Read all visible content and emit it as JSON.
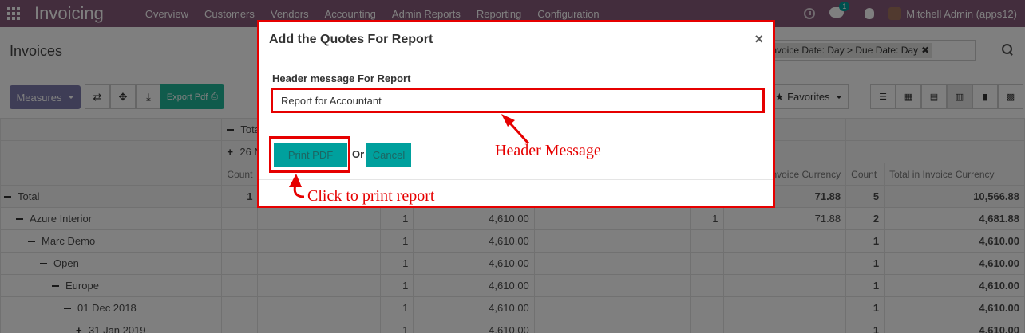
{
  "navbar": {
    "brand": "Invoicing",
    "menu": [
      "Overview",
      "Customers",
      "Vendors",
      "Accounting",
      "Admin Reports",
      "Reporting",
      "Configuration"
    ],
    "chat_badge": "1",
    "user": "Mitchell Admin (apps12)"
  },
  "control_panel": {
    "title": "Invoices",
    "facet": "Invoice Date: Day > Due Date: Day",
    "measures_label": "Measures",
    "export_label": "Export Pdf",
    "favorites_label": "Favorites"
  },
  "pivot": {
    "header_total": "Total",
    "header_col": "26 N",
    "subheaders": [
      "Count",
      "Invoice Currency",
      "Count",
      "Total in Invoice Currency"
    ],
    "rows": [
      {
        "label": "Total",
        "level": 0,
        "icon": "minus",
        "bold": true,
        "c1": "1",
        "c2": "",
        "c3": "",
        "c4": "",
        "c5": "",
        "c6": "71.88",
        "c7": "5",
        "c8": "10,566.88"
      },
      {
        "label": "Azure Interior",
        "level": 1,
        "icon": "minus",
        "bold": false,
        "c1": "",
        "c2": "",
        "c3": "1",
        "c4": "4,610.00",
        "c5": "1",
        "c6": "71.88",
        "c7": "2",
        "c8": "4,681.88"
      },
      {
        "label": "Marc Demo",
        "level": 2,
        "icon": "minus",
        "bold": false,
        "c1": "",
        "c2": "",
        "c3": "1",
        "c4": "4,610.00",
        "c5": "",
        "c6": "",
        "c7": "1",
        "c8": "4,610.00"
      },
      {
        "label": "Open",
        "level": 3,
        "icon": "minus",
        "bold": false,
        "c1": "",
        "c2": "",
        "c3": "1",
        "c4": "4,610.00",
        "c5": "",
        "c6": "",
        "c7": "1",
        "c8": "4,610.00"
      },
      {
        "label": "Europe",
        "level": 4,
        "icon": "minus",
        "bold": false,
        "c1": "",
        "c2": "",
        "c3": "1",
        "c4": "4,610.00",
        "c5": "",
        "c6": "",
        "c7": "1",
        "c8": "4,610.00"
      },
      {
        "label": "01 Dec 2018",
        "level": 5,
        "icon": "minus",
        "bold": false,
        "c1": "",
        "c2": "",
        "c3": "1",
        "c4": "4,610.00",
        "c5": "",
        "c6": "",
        "c7": "1",
        "c8": "4,610.00"
      },
      {
        "label": "31 Jan 2019",
        "level": 6,
        "icon": "plus",
        "bold": false,
        "c1": "",
        "c2": "",
        "c3": "1",
        "c4": "4,610.00",
        "c5": "",
        "c6": "",
        "c7": "1",
        "c8": "4,610.00"
      }
    ]
  },
  "modal": {
    "title": "Add the Quotes For Report",
    "close": "×",
    "field_label": "Header message For Report",
    "field_value": "Report for Accountant",
    "print_label": "Print PDF",
    "or_label": "Or",
    "cancel_label": "Cancel"
  },
  "annotations": {
    "header_message": "Header Message",
    "click_print": "Click to print report",
    "color": "#e60000"
  }
}
